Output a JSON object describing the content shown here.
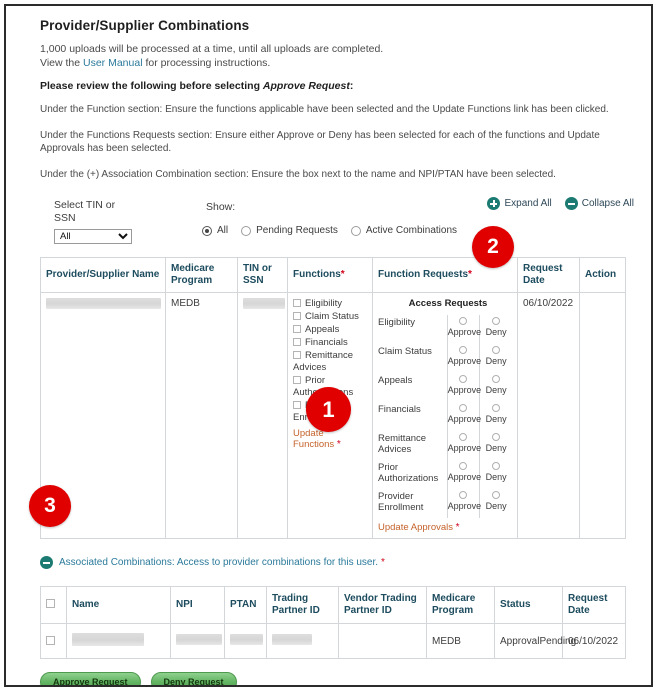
{
  "header": {
    "title": "Provider/Supplier Combinations",
    "lede_line1": "1,000 uploads will be processed at a time, until all uploads are completed.",
    "lede_line2_prefix": "View the ",
    "lede_link": "User Manual",
    "lede_line2_suffix": " for processing instructions.",
    "review_prefix": "Please review the following before selecting ",
    "review_italic": "Approve Request",
    "review_suffix": ":",
    "bullets": [
      "Under the Function section: Ensure the functions applicable have been selected and the Update Functions link has been clicked.",
      "Under the Functions Requests section: Ensure either Approve or Deny has been selected for each of the functions and Update Approvals has been selected.",
      "Under the (+) Association Combination section: Ensure the box next to the name and NPI/PTAN have been selected."
    ]
  },
  "controls": {
    "tin_label": "Select TIN or SSN",
    "tin_selected": "All",
    "tin_options": [
      "All"
    ],
    "show_label": "Show:",
    "radios": [
      {
        "label": "All",
        "selected": true
      },
      {
        "label": "Pending Requests",
        "selected": false
      },
      {
        "label": "Active Combinations",
        "selected": false
      }
    ],
    "expand_all": "Expand All",
    "collapse_all": "Collapse All"
  },
  "main_table": {
    "columns": [
      "Provider/Supplier Name",
      "Medicare Program",
      "TIN or SSN",
      "Functions",
      "Function Requests",
      "Request Date",
      "Action"
    ],
    "required_columns": [
      "Functions",
      "Function Requests"
    ],
    "row": {
      "provider_name": "",
      "medicare_program": "MEDB",
      "tin_or_ssn": "",
      "request_date": "06/10/2022",
      "action": "",
      "functions": [
        "Eligibility",
        "Claim Status",
        "Appeals",
        "Financials",
        "Remittance Advices",
        "Prior Authorizations",
        "Provider Enrollment"
      ],
      "update_functions_link": "Update Functions",
      "access_requests_title": "Access Requests",
      "function_requests": [
        {
          "name": "Eligibility",
          "approve_label": "Approve",
          "deny_label": "Deny"
        },
        {
          "name": "Claim Status",
          "approve_label": "Approve",
          "deny_label": "Deny"
        },
        {
          "name": "Appeals",
          "approve_label": "Approve",
          "deny_label": "Deny"
        },
        {
          "name": "Financials",
          "approve_label": "Approve",
          "deny_label": "Deny"
        },
        {
          "name": "Remittance Advices",
          "approve_label": "Approve",
          "deny_label": "Deny"
        },
        {
          "name": "Prior Authorizations",
          "approve_label": "Approve",
          "deny_label": "Deny"
        },
        {
          "name": "Provider Enrollment",
          "approve_label": "Approve",
          "deny_label": "Deny"
        }
      ],
      "update_approvals_link": "Update Approvals"
    }
  },
  "associated": {
    "text": "Associated Combinations: Access to provider combinations for this user.",
    "columns": [
      "Name",
      "NPI",
      "PTAN",
      "Trading Partner ID",
      "Vendor Trading Partner ID",
      "Medicare Program",
      "Status",
      "Request Date"
    ],
    "row": {
      "name": "",
      "npi": "",
      "ptan": "",
      "trading_partner_id": "",
      "vendor_trading_partner_id": "",
      "medicare_program": "MEDB",
      "status": "ApprovalPending",
      "request_date": "06/10/2022"
    }
  },
  "buttons": {
    "approve": "Approve Request",
    "deny": "Deny Request"
  },
  "callouts": [
    {
      "id": "1",
      "number": "1"
    },
    {
      "id": "2",
      "number": "2"
    },
    {
      "id": "3",
      "number": "3"
    }
  ],
  "colors": {
    "badge_red": "#e00000",
    "teal_icon": "#1b7b72",
    "header_text": "#1d4c5e",
    "link_orange": "#c4622a",
    "required_star": "#d0021b",
    "button_green": "#63b463"
  }
}
